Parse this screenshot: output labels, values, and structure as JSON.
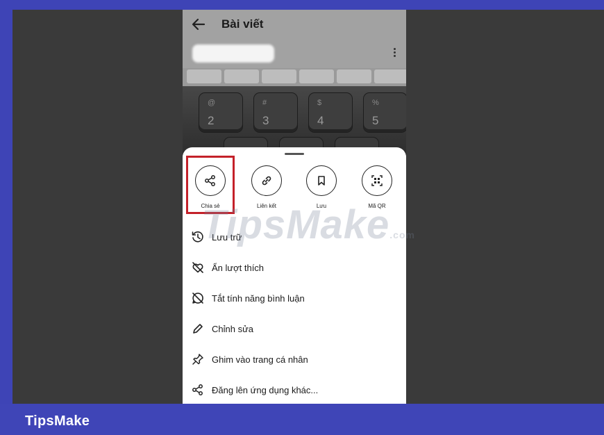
{
  "header": {
    "title": "Bài viết"
  },
  "share_sheet": {
    "actions": [
      {
        "label": "Chia sẻ",
        "icon": "share-icon"
      },
      {
        "label": "Liên kết",
        "icon": "link-icon"
      },
      {
        "label": "Lưu",
        "icon": "bookmark-icon"
      },
      {
        "label": "Mã QR",
        "icon": "qr-code-icon"
      }
    ],
    "menu": [
      {
        "label": "Lưu trữ",
        "icon": "archive-icon"
      },
      {
        "label": "Ẩn lượt thích",
        "icon": "hide-likes-icon"
      },
      {
        "label": "Tắt tính năng bình luận",
        "icon": "comments-off-icon"
      },
      {
        "label": "Chỉnh sửa",
        "icon": "edit-pencil-icon"
      },
      {
        "label": "Ghim vào trang cá nhân",
        "icon": "pin-icon"
      },
      {
        "label": "Đăng lên ứng dụng khác...",
        "icon": "share-icon"
      }
    ]
  },
  "keyboard_photo": {
    "keys": [
      "2",
      "3",
      "4",
      "5"
    ]
  },
  "watermark": {
    "main": "TipsMake",
    "suffix": ".com"
  },
  "brand": {
    "text": "TipsMake"
  },
  "colors": {
    "frame": "#3e44b6",
    "highlight": "#c4212a",
    "backdrop": "#3a3a3a"
  }
}
